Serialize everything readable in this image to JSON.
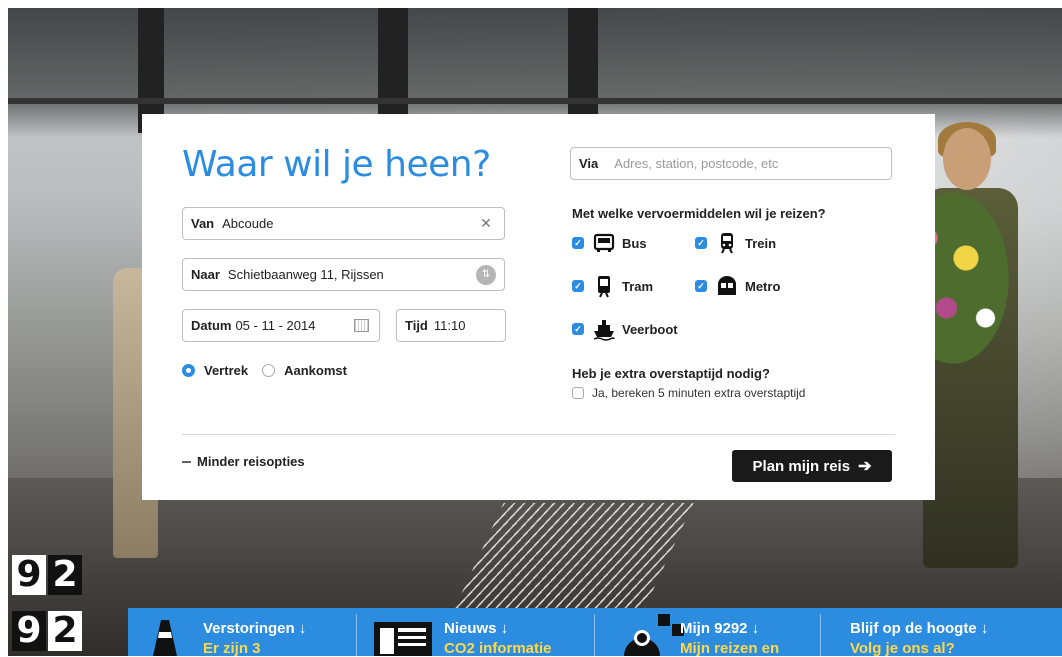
{
  "search": {
    "title": "Waar wil je heen?",
    "from": {
      "label": "Van",
      "value": "Abcoude"
    },
    "to": {
      "label": "Naar",
      "value": "Schietbaanweg 11, Rijssen"
    },
    "date": {
      "label": "Datum",
      "value": "05 - 11 - 2014"
    },
    "time": {
      "label": "Tijd",
      "value": "11:10"
    },
    "via": {
      "label": "Via",
      "placeholder": "Adres, station, postcode, etc"
    },
    "departure_label": "Vertrek",
    "arrival_label": "Aankomst",
    "selected": "Vertrek"
  },
  "transport": {
    "question": "Met welke vervoermiddelen wil je reizen?",
    "modes": [
      {
        "label": "Bus",
        "checked": true,
        "icon": "bus-icon"
      },
      {
        "label": "Trein",
        "checked": true,
        "icon": "train-icon"
      },
      {
        "label": "Tram",
        "checked": true,
        "icon": "tram-icon"
      },
      {
        "label": "Metro",
        "checked": true,
        "icon": "metro-icon"
      },
      {
        "label": "Veerboot",
        "checked": true,
        "icon": "ferry-icon"
      }
    ]
  },
  "transfer": {
    "question": "Heb je extra overstaptijd nodig?",
    "option": "Ja, bereken 5 minuten extra overstaptijd",
    "checked": false
  },
  "actions": {
    "fewer_options": "Minder reisopties",
    "plan": "Plan mijn reis"
  },
  "logo": {
    "digits": [
      "9",
      "2",
      "9",
      "2"
    ]
  },
  "nav": {
    "items": [
      {
        "title": "Verstoringen",
        "subtitle": "Er zijn 3",
        "icon": "cone-icon"
      },
      {
        "title": "Nieuws",
        "subtitle": "CO2 informatie",
        "icon": "newspaper-icon"
      },
      {
        "title": "Mijn 9292",
        "subtitle": "Mijn reizen en",
        "icon": "user-icon"
      },
      {
        "title": "Blijf op de hoogte",
        "subtitle": "Volg je ons al?",
        "icon": ""
      }
    ],
    "arrow": "↓"
  },
  "colors": {
    "accent": "#2b8ce0",
    "dark": "#1a1a1a",
    "highlight": "#ffd84a"
  }
}
